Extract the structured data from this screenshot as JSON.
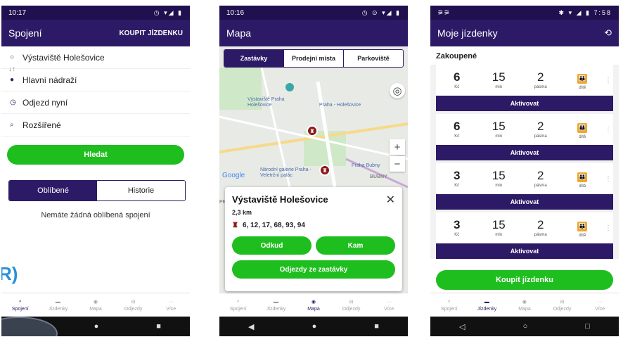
{
  "screens": {
    "connections": {
      "status_time": "10:17",
      "title": "Spojení",
      "action": "KOUPIT JÍZDENKU",
      "from_stop": "Výstaviště Holešovice",
      "to_stop": "Hlavní nádraží",
      "departure": "Odjezd nyní",
      "advanced": "Rozšířené",
      "search_button": "Hledat",
      "tabs": [
        "Oblíbené",
        "Historie"
      ],
      "empty_message": "Nemáte žádná oblíbená spojení",
      "overlay_text": "R)"
    },
    "map": {
      "status_time": "10:16",
      "title": "Mapa",
      "tabs": [
        "Zastávky",
        "Prodejní místa",
        "Parkoviště"
      ],
      "labels": {
        "vystaviste": "Výstaviště Praha Holešovice",
        "praha_holesovice": "Praha - Holešovice",
        "narodni_galerie": "Národní galerie Praha - Veletržní palác",
        "praha_bubny": "Praha Bubny",
        "bubny": "BUBNY",
        "google": "Google",
        "pr": "PR"
      },
      "card": {
        "stop_name": "Výstaviště Holešovice",
        "distance": "2,3 km",
        "lines": "6, 12, 17, 68, 93, 94",
        "from_button": "Odkud",
        "to_button": "Kam",
        "departures_button": "Odjezdy ze zastávky"
      }
    },
    "tickets": {
      "status_time": "7:58",
      "title": "Moje jízdenky",
      "section": "Zakoupené",
      "tickets": [
        {
          "price": "6",
          "price_unit": "Kč",
          "minutes": "15",
          "minutes_unit": "min",
          "zones": "2",
          "zones_unit": "pásma",
          "type": "dítě",
          "activate": "Aktivovat"
        },
        {
          "price": "6",
          "price_unit": "Kč",
          "minutes": "15",
          "minutes_unit": "min",
          "zones": "2",
          "zones_unit": "pásma",
          "type": "dítě",
          "activate": "Aktivovat"
        },
        {
          "price": "3",
          "price_unit": "Kč",
          "minutes": "15",
          "minutes_unit": "min",
          "zones": "2",
          "zones_unit": "pásma",
          "type": "dítě",
          "activate": "Aktivovat"
        },
        {
          "price": "3",
          "price_unit": "Kč",
          "minutes": "15",
          "minutes_unit": "min",
          "zones": "2",
          "zones_unit": "pásma",
          "type": "dítě",
          "activate": "Aktivovat"
        }
      ],
      "buy_button": "Koupit jízdenku"
    }
  },
  "nav": {
    "items": [
      "Spojení",
      "Jízdenky",
      "Mapa",
      "Odjezdy",
      "Více"
    ],
    "icons": [
      "search-icon",
      "ticket-icon",
      "compass-icon",
      "bus-icon",
      "more-icon"
    ]
  },
  "colors": {
    "primary": "#2d1a66",
    "status_bar": "#21104f",
    "green": "#1fbe1f",
    "child_badge": "#f5a623",
    "stop_pin": "#8b1a1a"
  }
}
